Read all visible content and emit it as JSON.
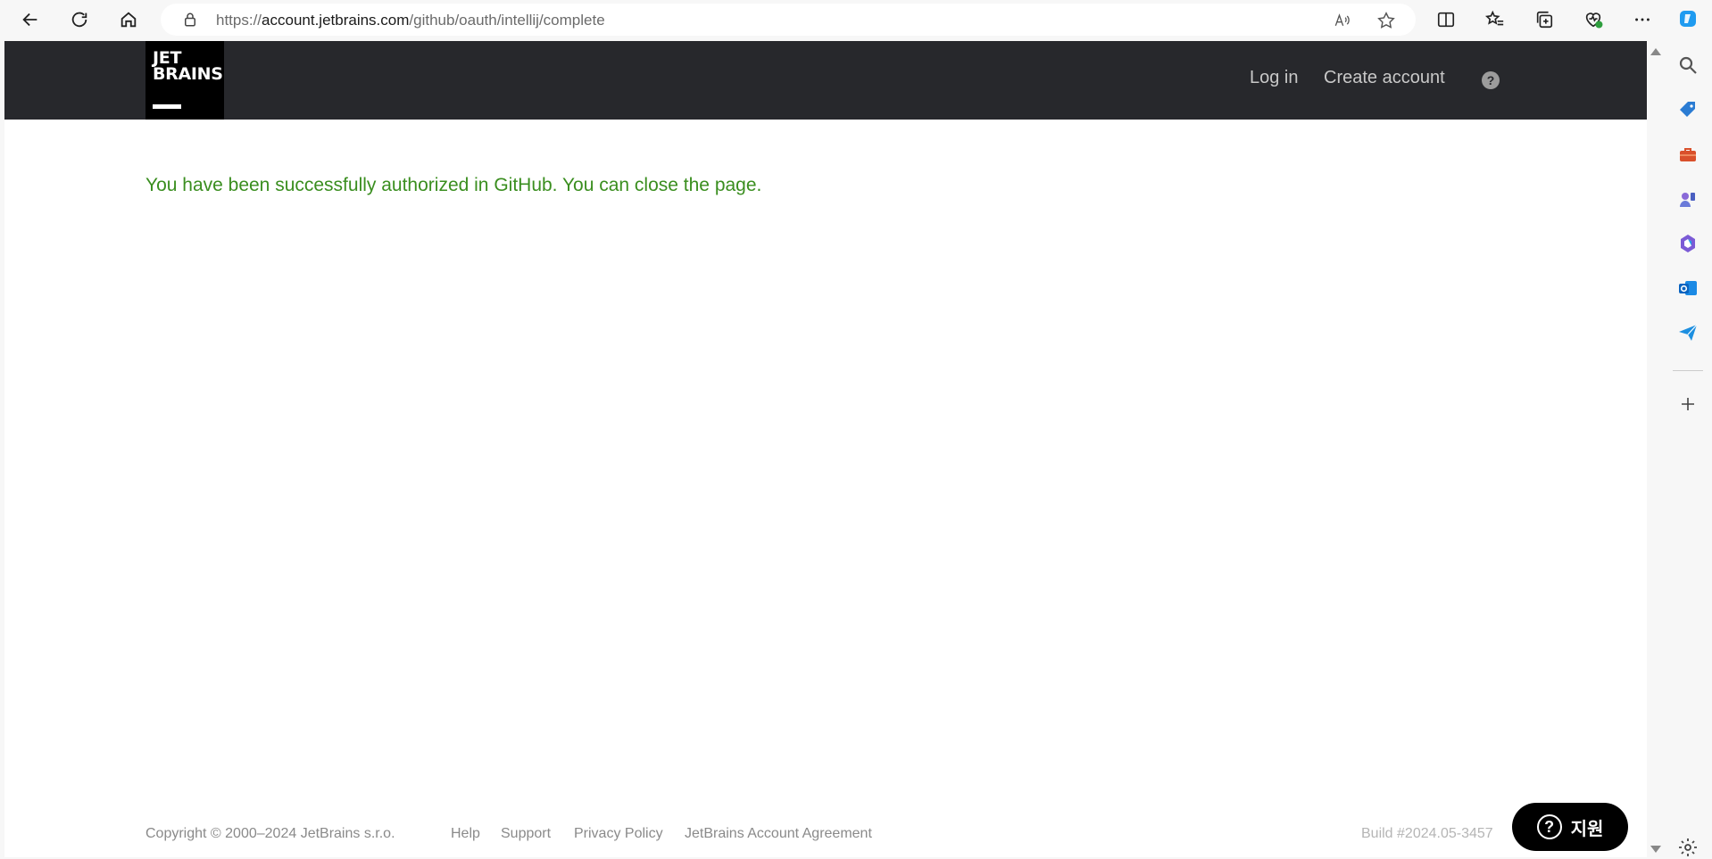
{
  "browser": {
    "url_prefix": "https://",
    "url_host": "account.jetbrains.com",
    "url_path": "/github/oauth/intellij/complete"
  },
  "header": {
    "logo_text": "JET\nBRAINS",
    "login": "Log in",
    "create_account": "Create account",
    "help": "?"
  },
  "main": {
    "message": "You have been successfully authorized in GitHub. You can close the page."
  },
  "footer": {
    "copyright": "Copyright © 2000–2024 JetBrains s.r.o.",
    "links": [
      "Help",
      "Support",
      "Privacy Policy",
      "JetBrains Account Agreement"
    ],
    "build": "Build #2024.05-3457"
  },
  "support_widget": {
    "label": "지원",
    "icon": "?"
  },
  "colors": {
    "header_bg": "#27282c",
    "success_text": "#3a8e1f"
  }
}
